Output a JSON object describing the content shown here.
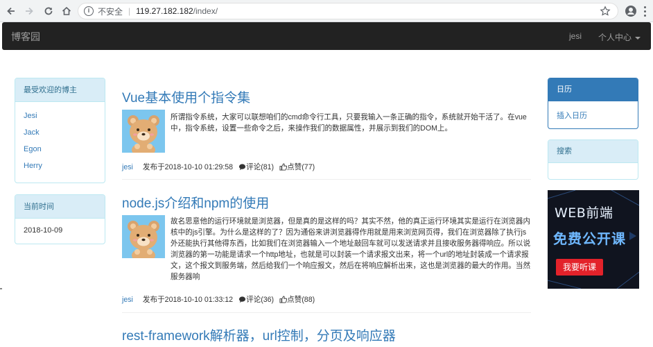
{
  "browser": {
    "security_label": "不安全",
    "url_host": "119.27.182.182",
    "url_path": "/index/"
  },
  "navbar": {
    "brand": "博客园",
    "user": "jesi",
    "user_center": "个人中心"
  },
  "left_panels": {
    "popular": {
      "title": "最受欢迎的博主",
      "items": [
        "Jesi",
        "Jack",
        "Egon",
        "Herry"
      ]
    },
    "time": {
      "title": "当前时间",
      "value": "2018-10-09"
    }
  },
  "articles": [
    {
      "title": "Vue基本使用个指令集",
      "desc": "所谓指令系统，大家可以联想咱们的cmd命令行工具，只要我输入一条正确的指令，系统就开始干活了。在vue中，指令系统，设置一些命令之后，来操作我们的数据属性，并展示到我们的DOM上。",
      "author": "jesi",
      "date": "发布于2018-10-10 01:29:58",
      "comments": "评论(81)",
      "likes": "点赞(77)"
    },
    {
      "title": "node.js介绍和npm的使用",
      "desc": "故名思意他的运行环境就是浏览器，但是真的是这样的吗？其实不然，他的真正运行环境其实是运行在浏览器内核中的js引擎。为什么是这样的了？因为通俗来讲浏览器得作用就是用来浏览网页得，我们在浏览器除了执行js外还能执行其他得东西，比如我们在浏览器输入一个地址敲回车就可以发送请求并且接收服务器得响应。所以说浏览器的第一功能是请求一个http地址，也就是可以封装一个请求报文出来，将一个url的地址封装成一个请求报文，这个报文到服务端，然后给我们一个响应报文，然后在将响应解析出来，这也是浏览器的最大的作用。当然服务器响",
      "author": "jesi",
      "date": "发布于2018-10-10 01:33:12",
      "comments": "评论(36)",
      "likes": "点赞(88)"
    },
    {
      "title": "rest-framework解析器，url控制，分页及响应器"
    }
  ],
  "right_panels": {
    "calendar": {
      "title": "日历",
      "link": "插入日历"
    },
    "search": {
      "title": "搜索"
    }
  },
  "ad": {
    "line1": "WEB前端",
    "line2": "免费公开课",
    "button": "我要听课",
    "bg_color": "#10141f",
    "accent_color": "#6fb8ff",
    "button_color": "#e3222a"
  },
  "icons": {
    "back": "arrow-left-icon",
    "forward": "arrow-right-icon",
    "reload": "reload-icon",
    "home": "home-icon",
    "info": "info-icon",
    "star": "star-icon",
    "profile": "account-circle-icon",
    "menu": "more-vert-icon",
    "comment": "comment-icon",
    "like": "thumbs-up-icon"
  }
}
